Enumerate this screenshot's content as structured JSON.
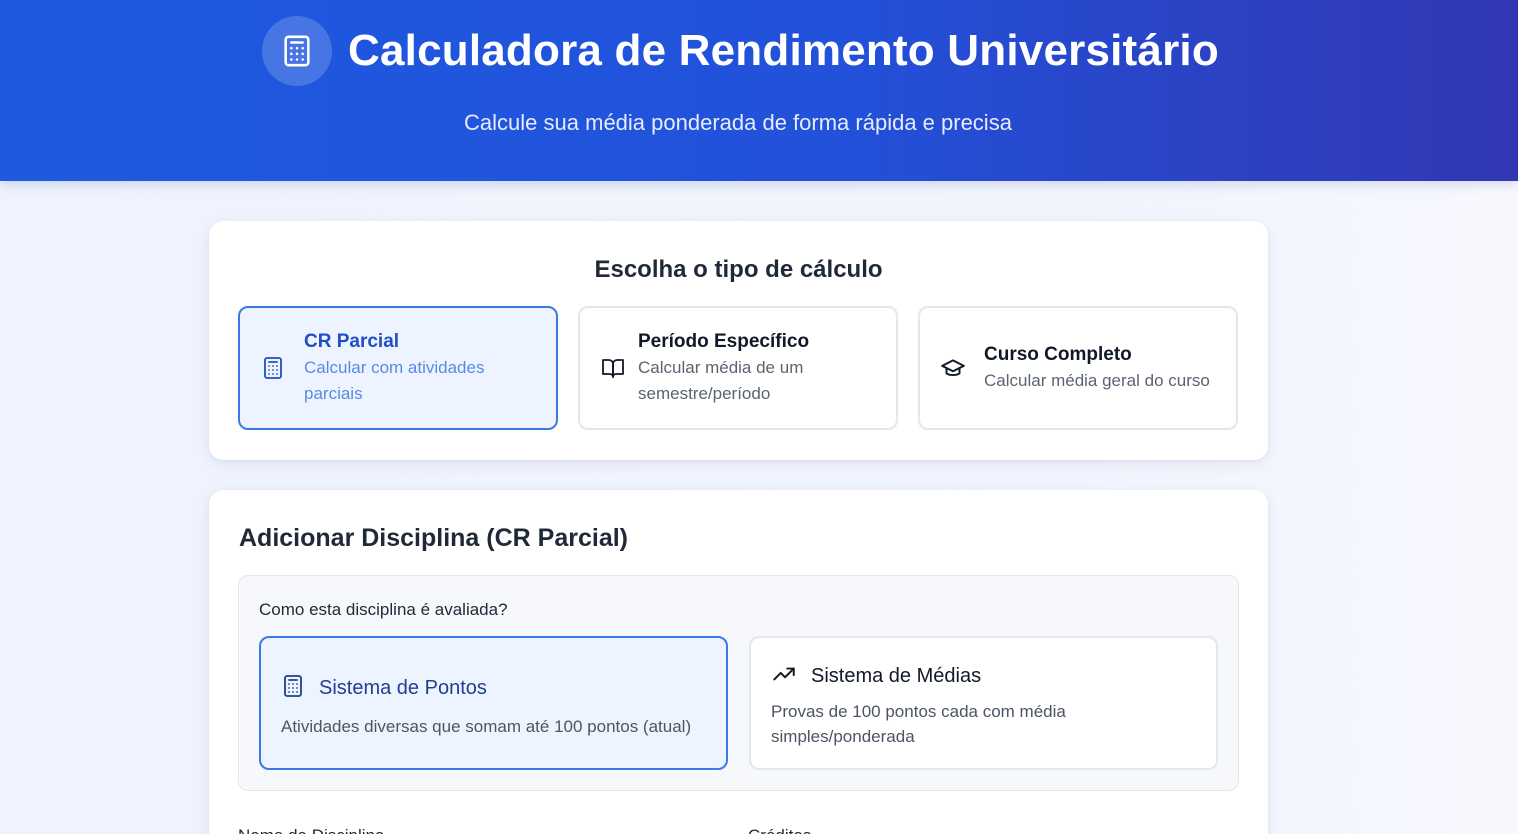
{
  "header": {
    "title": "Calculadora de Rendimento Universitário",
    "subtitle": "Calcule sua média ponderada de forma rápida e precisa",
    "icon": "calculator-icon"
  },
  "calc_type": {
    "title": "Escolha o tipo de cálculo",
    "options": [
      {
        "label": "CR Parcial",
        "desc": "Calcular com atividades parciais",
        "icon": "calculator-icon",
        "selected": true
      },
      {
        "label": "Período Específico",
        "desc": "Calcular média de um semestre/período",
        "icon": "book-open-icon",
        "selected": false
      },
      {
        "label": "Curso Completo",
        "desc": "Calcular média geral do curso",
        "icon": "graduation-cap-icon",
        "selected": false
      }
    ]
  },
  "discipline": {
    "title": "Adicionar Disciplina (CR Parcial)",
    "eval_question": "Como esta disciplina é avaliada?",
    "systems": [
      {
        "label": "Sistema de Pontos",
        "desc": "Atividades diversas que somam até 100 pontos (atual)",
        "icon": "calculator-icon",
        "selected": true
      },
      {
        "label": "Sistema de Médias",
        "desc": "Provas de 100 pontos cada com média simples/ponderada",
        "icon": "trending-up-icon",
        "selected": false
      }
    ],
    "field_labels": {
      "name": "Nome da Disciplina",
      "credits": "Créditos"
    }
  },
  "colors": {
    "accent": "#3b7ae6",
    "header_start": "#1d5ae0",
    "header_end": "#3237b2"
  }
}
